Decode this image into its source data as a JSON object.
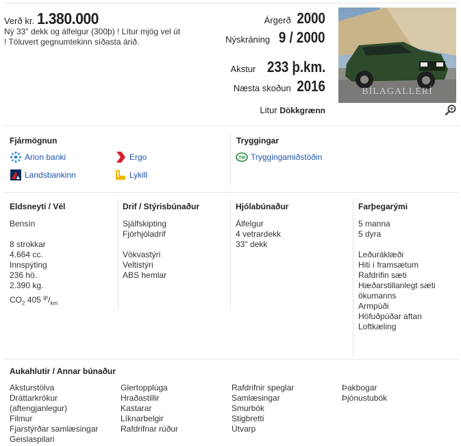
{
  "header": {
    "price_label": "Verð kr.",
    "price": "1.380.000",
    "description": "Ný 33\" dekk og álfelgur (300þ) ! Lítur mjög vel út ! Töluvert gegnumtekinn síðasta árið.",
    "year_label": "Árgerð",
    "year": "2000",
    "reg_label": "Nýskráning",
    "reg": "9 / 2000",
    "km_label": "Akstur",
    "km": "233 þ.km.",
    "insp_label": "Næsta skoðun",
    "insp": "2016",
    "color_label": "Litur",
    "color": "Dökkgrænn",
    "photo_watermark": "BÍLAGALLERÍ"
  },
  "finance": {
    "title": "Fjármögnun",
    "items": [
      {
        "label": "Arion banki",
        "icon": "arion-icon"
      },
      {
        "label": "Ergo",
        "icon": "ergo-icon"
      },
      {
        "label": "Landsbankinn",
        "icon": "landsbankinn-icon"
      },
      {
        "label": "Lykill",
        "icon": "lykill-icon"
      }
    ]
  },
  "insurance": {
    "title": "Tryggingar",
    "items": [
      {
        "label": "Tryggingamiðstöðin",
        "icon": "tm-icon"
      }
    ]
  },
  "specs": {
    "fuel": {
      "title": "Eldsneyti / Vél",
      "fuel_type": "Bensín",
      "lines": [
        "8 strokkar",
        "4.664 cc.",
        "Innspýting",
        "236 hö.",
        "2.390 kg."
      ],
      "co2_prefix": "CO",
      "co2_sub": "2",
      "co2_value": "405",
      "co2_unit_sup": "gr",
      "co2_unit_sub": "km"
    },
    "drive": {
      "title": "Drif / Stýrisbúnaður",
      "group1": [
        "Sjálfskipting",
        "Fjórhjóladrif"
      ],
      "group2": [
        "Vökvastýri",
        "Veltistýri",
        "ABS hemlar"
      ]
    },
    "wheels": {
      "title": "Hjólabúnaður",
      "lines": [
        "Álfelgur",
        "4 vetrardekk",
        "33\" dekk"
      ]
    },
    "passenger": {
      "title": "Farþegarými",
      "group1": [
        "5 manna",
        "5 dyra"
      ],
      "group2": [
        "Leðuráklæði",
        "Hiti í framsætum",
        "Rafdrifin sæti",
        "Hæðarstillanlegt sæti",
        "ökumanns",
        "Armpúði",
        "Höfuðpúðar aftan",
        "Loftkæling"
      ]
    }
  },
  "accessories": {
    "title": "Aukahlutir / Annar búnaður",
    "col1": [
      "Aksturstölva",
      "Dráttarkrókur",
      "(aftengjanlegur)",
      "Filmur",
      "Fjarstýrðar samlæsingar",
      "Geislaspilari"
    ],
    "col2": [
      "Glertopplúga",
      "Hraðastillir",
      "Kastarar",
      "Líknarbelgir",
      "Rafdrifnar rúður"
    ],
    "col3": [
      "Rafdrifnir speglar",
      "Samlæsingar",
      "Smurbók",
      "Stigbretti",
      "Útvarp"
    ],
    "col4": [
      "Þakbogar",
      "Þjónustubók"
    ]
  }
}
